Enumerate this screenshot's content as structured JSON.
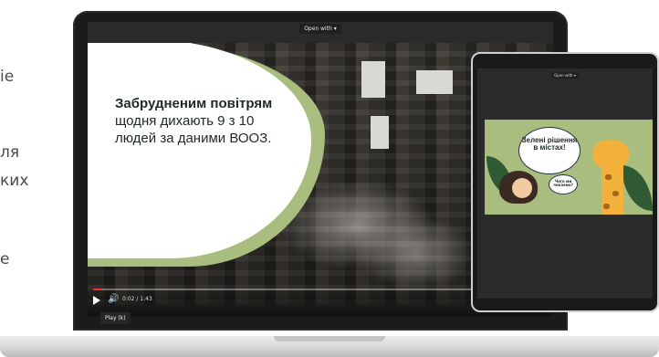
{
  "left_page_fragments": [
    "іе",
    "ля",
    "ких",
    "е"
  ],
  "laptop": {
    "open_with_label": "Open with",
    "open_with_arrow": "▾",
    "slide": {
      "bold_text": "Забрудненим повітрям",
      "regular_text": " щодня дихають 9 з 10 людей за даними ВООЗ."
    },
    "player": {
      "time": "0:02 / 1:43",
      "progress": 0.02,
      "tooltip": "Play (k)",
      "volume_icon": "🔊"
    }
  },
  "tablet": {
    "open_with_label": "Open with",
    "open_with_arrow": "▾",
    "slide": {
      "bubble_text": "Зелені рішення в містах!",
      "small_bubble_text": "Чого ми чекаємо?"
    }
  },
  "colors": {
    "slide_green": "#a9bd7e",
    "progress_red": "#e33"
  }
}
